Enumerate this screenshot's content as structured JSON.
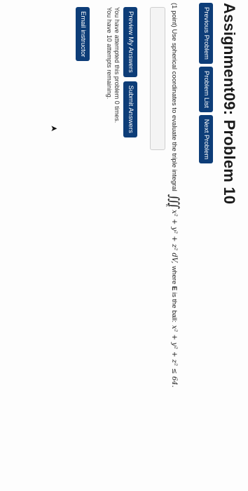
{
  "header": {
    "title": "Assignment09: Problem 10"
  },
  "nav": {
    "previous_label": "Previous Problem",
    "list_label": "Problem List",
    "next_label": "Next Problem"
  },
  "problem": {
    "text_before": "(1 point) Use spherical coordinates to evaluate the triple integral",
    "integral_symbol": "∭",
    "region": "E",
    "integrand": "x² + y² + z² dV,",
    "text_middle": "where",
    "region_bold": "E",
    "text_after": "is the ball:",
    "condition": "x² + y² + z² ≤ 64."
  },
  "actions": {
    "preview_label": "Preview My Answers",
    "submit_label": "Submit Answers"
  },
  "status": {
    "attempted": "You have attempted this problem 0 times.",
    "remaining": "You have 10 attempts remaining."
  },
  "footer": {
    "email_label": "Email instructor"
  },
  "colors": {
    "button_bg": "#0d3d78",
    "button_text": "#ffffff"
  },
  "icons": {
    "pointer": "mouse-pointer-icon"
  }
}
